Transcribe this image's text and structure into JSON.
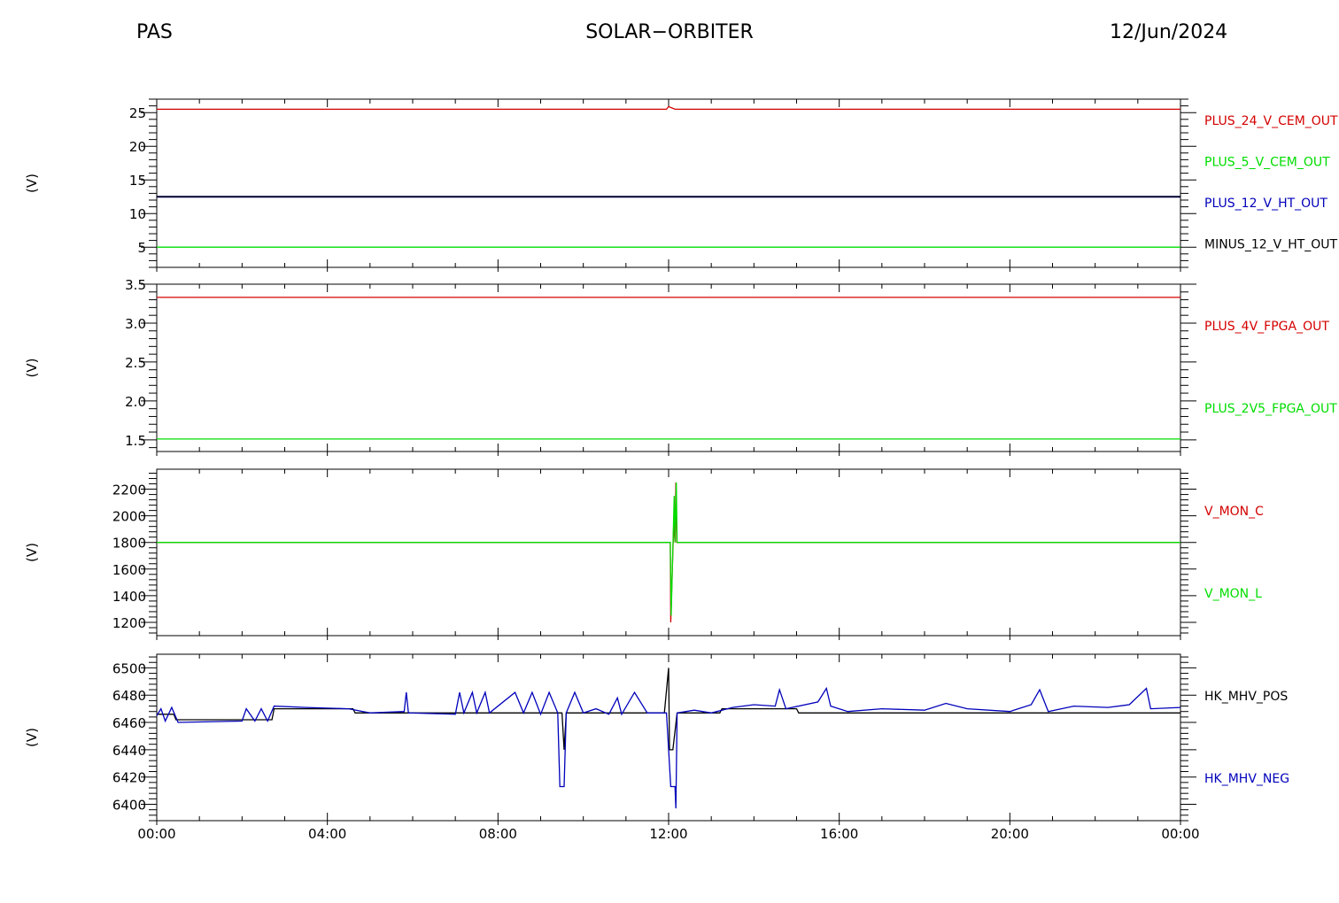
{
  "header": {
    "left": "PAS",
    "center": "SOLAR−ORBITER",
    "right": "12/Jun/2024"
  },
  "colors": {
    "red": "#d40000",
    "green": "#00dd00",
    "blue": "#0000bb",
    "black": "#000000"
  },
  "chart_data": [
    {
      "type": "line",
      "ylabel": "(V)",
      "ylim": [
        2,
        27
      ],
      "yticks": [
        5,
        10,
        15,
        20,
        25
      ],
      "x": [
        "00:00",
        "04:00",
        "08:00",
        "12:00",
        "16:00",
        "20:00",
        "00:00"
      ],
      "series": [
        {
          "name": "PLUS_24_V_CEM_OUT",
          "color": "#d40000",
          "points": [
            [
              0,
              25.5
            ],
            [
              11.95,
              25.5
            ],
            [
              12.0,
              25.9
            ],
            [
              12.15,
              25.5
            ],
            [
              24,
              25.5
            ]
          ]
        },
        {
          "name": "PLUS_5_V_CEM_OUT",
          "color": "#00dd00",
          "points": [
            [
              0,
              5.0
            ],
            [
              24,
              5.0
            ]
          ]
        },
        {
          "name": "PLUS_12_V_HT_OUT",
          "color": "#0000bb",
          "points": [
            [
              0,
              12.5
            ],
            [
              24,
              12.5
            ]
          ]
        },
        {
          "name": "MINUS_12_V_HT_OUT",
          "color": "#000000",
          "points": [
            [
              0,
              12.5
            ],
            [
              24,
              12.5
            ]
          ]
        }
      ]
    },
    {
      "type": "line",
      "ylabel": "(V)",
      "ylim": [
        1.35,
        3.5
      ],
      "yticks": [
        1.5,
        2.0,
        2.5,
        3.0,
        3.5
      ],
      "x": [
        "00:00",
        "04:00",
        "08:00",
        "12:00",
        "16:00",
        "20:00",
        "00:00"
      ],
      "series": [
        {
          "name": "PLUS_4V_FPGA_OUT",
          "color": "#d40000",
          "points": [
            [
              0,
              3.33
            ],
            [
              24,
              3.33
            ]
          ]
        },
        {
          "name": "PLUS_2V5_FPGA_OUT",
          "color": "#00dd00",
          "points": [
            [
              0,
              1.51
            ],
            [
              24,
              1.51
            ]
          ]
        }
      ]
    },
    {
      "type": "line",
      "ylabel": "(V)",
      "ylim": [
        1100,
        2350
      ],
      "yticks": [
        1200,
        1400,
        1600,
        1800,
        2000,
        2200
      ],
      "x": [
        "00:00",
        "04:00",
        "08:00",
        "12:00",
        "16:00",
        "20:00",
        "00:00"
      ],
      "series": [
        {
          "name": "V_MON_C",
          "color": "#d40000",
          "points": [
            [
              0,
              1800
            ],
            [
              12.04,
              1800
            ],
            [
              12.05,
              1200
            ],
            [
              12.12,
              1950
            ],
            [
              12.15,
              1800
            ],
            [
              12.17,
              2250
            ],
            [
              12.19,
              1800
            ],
            [
              24,
              1800
            ]
          ]
        },
        {
          "name": "V_MON_L",
          "color": "#00dd00",
          "points": [
            [
              0,
              1800
            ],
            [
              12.04,
              1800
            ],
            [
              12.06,
              1250
            ],
            [
              12.13,
              2150
            ],
            [
              12.15,
              1800
            ],
            [
              12.18,
              2250
            ],
            [
              12.2,
              1800
            ],
            [
              24,
              1800
            ]
          ]
        }
      ]
    },
    {
      "type": "line",
      "ylabel": "(V)",
      "ylim": [
        6388,
        6510
      ],
      "yticks": [
        6400,
        6420,
        6440,
        6460,
        6480,
        6500
      ],
      "x": [
        "00:00",
        "04:00",
        "08:00",
        "12:00",
        "16:00",
        "20:00",
        "00:00"
      ],
      "series": [
        {
          "name": "HK_MHV_POS",
          "color": "#000000",
          "points": [
            [
              0,
              6466
            ],
            [
              0.4,
              6466
            ],
            [
              0.45,
              6462
            ],
            [
              2.7,
              6462
            ],
            [
              2.75,
              6470
            ],
            [
              4.6,
              6470
            ],
            [
              4.65,
              6467
            ],
            [
              9.5,
              6467
            ],
            [
              9.55,
              6440
            ],
            [
              9.6,
              6467
            ],
            [
              11.9,
              6467
            ],
            [
              12.0,
              6500
            ],
            [
              12.02,
              6440
            ],
            [
              12.1,
              6440
            ],
            [
              12.2,
              6467
            ],
            [
              13.2,
              6467
            ],
            [
              13.25,
              6470
            ],
            [
              15.0,
              6470
            ],
            [
              15.05,
              6467
            ],
            [
              24,
              6467
            ]
          ]
        },
        {
          "name": "HK_MHV_NEG",
          "color": "#0000bb",
          "points": [
            [
              0,
              6465
            ],
            [
              0.1,
              6470
            ],
            [
              0.2,
              6461
            ],
            [
              0.35,
              6471
            ],
            [
              0.5,
              6460
            ],
            [
              2.0,
              6461
            ],
            [
              2.1,
              6470
            ],
            [
              2.3,
              6461
            ],
            [
              2.45,
              6470
            ],
            [
              2.6,
              6461
            ],
            [
              2.75,
              6472
            ],
            [
              3.5,
              6471
            ],
            [
              4.5,
              6470
            ],
            [
              5.0,
              6467
            ],
            [
              5.8,
              6468
            ],
            [
              5.85,
              6482
            ],
            [
              5.9,
              6467
            ],
            [
              7.0,
              6466
            ],
            [
              7.1,
              6482
            ],
            [
              7.2,
              6467
            ],
            [
              7.4,
              6482
            ],
            [
              7.5,
              6467
            ],
            [
              7.7,
              6482
            ],
            [
              7.8,
              6467
            ],
            [
              8.4,
              6482
            ],
            [
              8.6,
              6467
            ],
            [
              8.8,
              6482
            ],
            [
              9.0,
              6466
            ],
            [
              9.2,
              6482
            ],
            [
              9.4,
              6467
            ],
            [
              9.45,
              6413
            ],
            [
              9.55,
              6413
            ],
            [
              9.6,
              6467
            ],
            [
              9.8,
              6482
            ],
            [
              10.0,
              6467
            ],
            [
              10.3,
              6470
            ],
            [
              10.6,
              6466
            ],
            [
              10.8,
              6478
            ],
            [
              10.9,
              6466
            ],
            [
              11.2,
              6482
            ],
            [
              11.5,
              6467
            ],
            [
              11.95,
              6467
            ],
            [
              12.05,
              6413
            ],
            [
              12.15,
              6413
            ],
            [
              12.17,
              6397
            ],
            [
              12.2,
              6467
            ],
            [
              12.6,
              6469
            ],
            [
              13.0,
              6467
            ],
            [
              13.5,
              6471
            ],
            [
              14.0,
              6473
            ],
            [
              14.5,
              6472
            ],
            [
              14.6,
              6484
            ],
            [
              14.75,
              6470
            ],
            [
              15.5,
              6475
            ],
            [
              15.7,
              6485
            ],
            [
              15.8,
              6472
            ],
            [
              16.2,
              6468
            ],
            [
              17.0,
              6470
            ],
            [
              18.0,
              6469
            ],
            [
              18.5,
              6474
            ],
            [
              19.0,
              6470
            ],
            [
              20.0,
              6468
            ],
            [
              20.5,
              6473
            ],
            [
              20.7,
              6484
            ],
            [
              20.9,
              6468
            ],
            [
              21.5,
              6472
            ],
            [
              22.3,
              6471
            ],
            [
              22.8,
              6473
            ],
            [
              23.2,
              6485
            ],
            [
              23.3,
              6470
            ],
            [
              24,
              6471
            ]
          ]
        }
      ]
    }
  ]
}
